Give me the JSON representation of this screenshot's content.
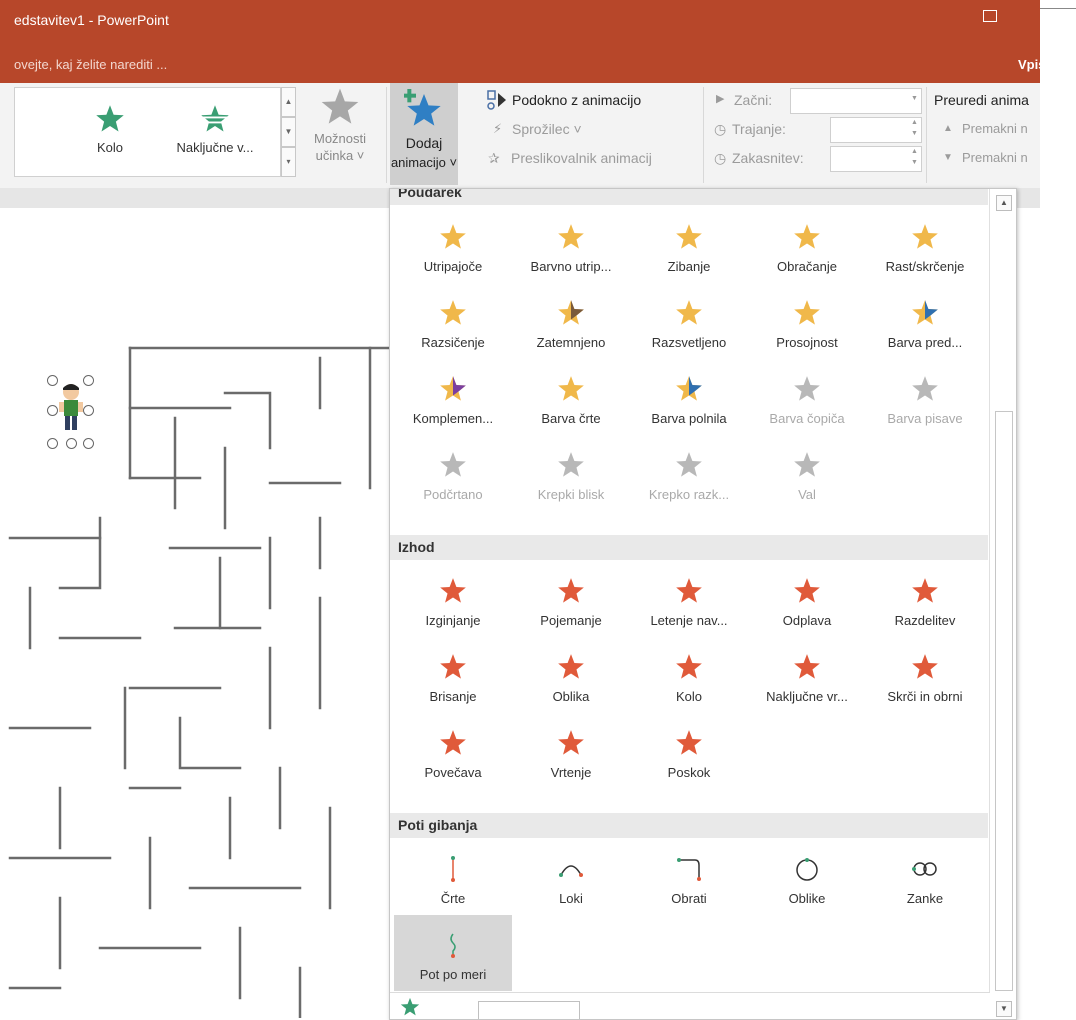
{
  "window": {
    "title": "edstavitev1 - PowerPoint"
  },
  "tellme": {
    "text": "ovejte, kaj želite narediti ...",
    "signin": "Vpis"
  },
  "ribbon": {
    "gallery": [
      {
        "label": "Kolo"
      },
      {
        "label": "Naključne v..."
      }
    ],
    "effect_options": {
      "label1": "Možnosti",
      "label2": "učinka ˅"
    },
    "add_animation": {
      "label1": "Dodaj",
      "label2": "animacijo ˅"
    },
    "animation_pane": "Podokno z animacijo",
    "trigger": "Sprožilec ˅",
    "painter": "Preslikovalnik animacij",
    "start": "Začni:",
    "duration": "Trajanje:",
    "delay": "Zakasnitev:",
    "reorder": "Preuredi anima",
    "move_earlier": "Premakni n",
    "move_later": "Premakni n"
  },
  "panel": {
    "sections": {
      "emphasis": "Poudarek",
      "exit": "Izhod",
      "motion": "Poti gibanja"
    },
    "emphasis": [
      {
        "label": "Utripajoče",
        "icon": "star-pulse-icon"
      },
      {
        "label": "Barvno utrip...",
        "icon": "star-sparkle-icon"
      },
      {
        "label": "Zibanje",
        "icon": "star-teeter-icon"
      },
      {
        "label": "Obračanje",
        "icon": "star-spin-icon"
      },
      {
        "label": "Rast/skrčenje",
        "icon": "star-grow-icon"
      },
      {
        "label": "Razsičenje",
        "icon": "star-desaturate-icon"
      },
      {
        "label": "Zatemnjeno",
        "icon": "star-darken-icon"
      },
      {
        "label": "Razsvetljeno",
        "icon": "star-lighten-icon"
      },
      {
        "label": "Prosojnost",
        "icon": "star-transparency-icon"
      },
      {
        "label": "Barva pred...",
        "icon": "star-object-color-icon"
      },
      {
        "label": "Komplemen...",
        "icon": "star-complementary-icon"
      },
      {
        "label": "Barva črte",
        "icon": "star-line-color-icon"
      },
      {
        "label": "Barva polnila",
        "icon": "star-fill-color-icon"
      },
      {
        "label": "Barva čopiča",
        "icon": "star-brush-color-icon",
        "disabled": true
      },
      {
        "label": "Barva pisave",
        "icon": "star-font-color-icon",
        "disabled": true
      },
      {
        "label": "Podčrtano",
        "icon": "star-underline-icon",
        "disabled": true
      },
      {
        "label": "Krepki blisk",
        "icon": "star-bold-flash-icon",
        "disabled": true
      },
      {
        "label": "Krepko razk...",
        "icon": "star-bold-reveal-icon",
        "disabled": true
      },
      {
        "label": "Val",
        "icon": "star-wave-icon",
        "disabled": true
      }
    ],
    "exit": [
      {
        "label": "Izginjanje",
        "icon": "star-disappear-icon"
      },
      {
        "label": "Pojemanje",
        "icon": "star-fade-icon"
      },
      {
        "label": "Letenje nav...",
        "icon": "star-fly-out-icon"
      },
      {
        "label": "Odplava",
        "icon": "star-float-out-icon"
      },
      {
        "label": "Razdelitev",
        "icon": "star-split-icon"
      },
      {
        "label": "Brisanje",
        "icon": "star-wipe-icon"
      },
      {
        "label": "Oblika",
        "icon": "star-shape-icon"
      },
      {
        "label": "Kolo",
        "icon": "star-wheel-icon"
      },
      {
        "label": "Naključne vr...",
        "icon": "star-random-bars-icon"
      },
      {
        "label": "Skrči in obrni",
        "icon": "star-shrink-turn-icon"
      },
      {
        "label": "Povečava",
        "icon": "star-zoom-icon"
      },
      {
        "label": "Vrtenje",
        "icon": "star-swivel-icon"
      },
      {
        "label": "Poskok",
        "icon": "star-bounce-icon"
      }
    ],
    "motion": [
      {
        "label": "Črte",
        "icon": "path-line-icon"
      },
      {
        "label": "Loki",
        "icon": "path-arc-icon"
      },
      {
        "label": "Obrati",
        "icon": "path-turn-icon"
      },
      {
        "label": "Oblike",
        "icon": "path-shape-icon"
      },
      {
        "label": "Zanke",
        "icon": "path-loop-icon"
      },
      {
        "label": "Pot po meri",
        "icon": "path-custom-icon",
        "selected": true
      }
    ]
  },
  "colors": {
    "brand": "#b7472a",
    "emphasis_star": "#f0b84a",
    "exit_star": "#e05a3a",
    "entrance_star": "#3a9e73",
    "disabled_star": "#b8b8b8"
  }
}
